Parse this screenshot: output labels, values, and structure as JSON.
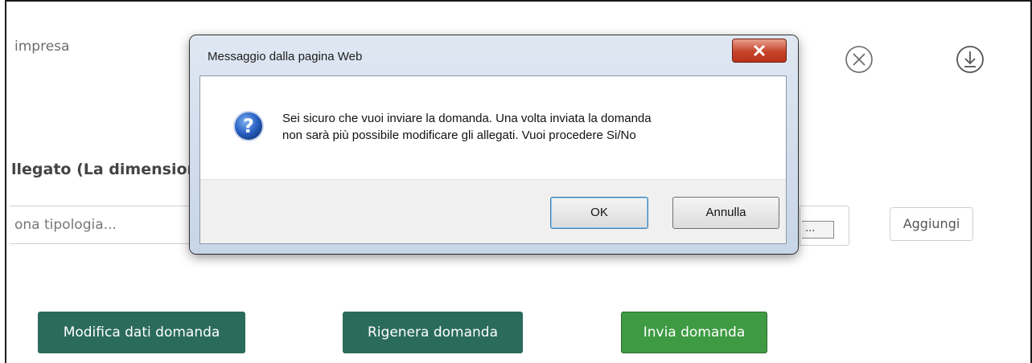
{
  "page": {
    "impresa_label": "impresa",
    "allegato_label": "llegato (La dimensior",
    "tipologia_placeholder": "ona tipologia...",
    "browse_label": "...",
    "aggiungi_label": "Aggiungi",
    "icons": {
      "close": "close-circle-icon",
      "download": "download-icon"
    },
    "actions": {
      "modifica": "Modifica dati domanda",
      "rigenera": "Rigenera domanda",
      "invia": "Invia domanda"
    },
    "colors": {
      "primary_button": "#2a6b5c",
      "invia_button": "#3e9b43"
    }
  },
  "dialog": {
    "title": "Messaggio dalla pagina Web",
    "icon": "question-icon",
    "message_line1": "Sei sicuro che vuoi inviare la domanda. Una volta inviata la domanda",
    "message_line2": "non sarà più possibile modificare gli allegati. Vuoi procedere Si/No",
    "ok_label": "OK",
    "cancel_label": "Annulla"
  }
}
